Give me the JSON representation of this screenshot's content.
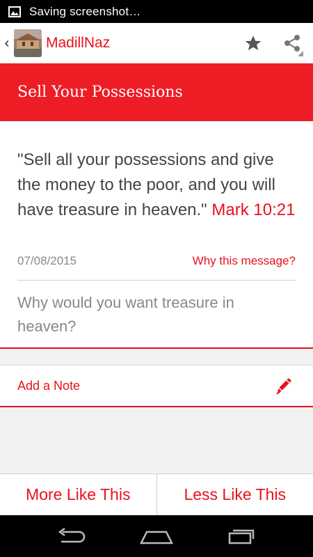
{
  "status_bar": {
    "notification_icon": "image-icon",
    "text": "Saving screenshot…"
  },
  "action_bar": {
    "back_icon": "chevron-left-icon",
    "logo_icon": "church-photo-icon",
    "app_title": "MadillNaz",
    "star_icon": "star-icon",
    "share_icon": "share-icon"
  },
  "message": {
    "title": "Sell Your Possessions",
    "verse_text": "\"Sell all your possessions and give the money to the poor, and you will have treasure in heaven.\"",
    "verse_reference": "Mark 10:21",
    "date": "07/08/2015",
    "why_link": "Why this message?",
    "question": "Why would you want treasure in heaven?"
  },
  "note": {
    "label": "Add a Note",
    "icon": "pencil-icon"
  },
  "feedback": {
    "more_label": "More Like This",
    "less_label": "Less Like This"
  },
  "nav_bar": {
    "back_icon": "back-arrow-icon",
    "home_icon": "home-icon",
    "recents_icon": "recent-apps-icon"
  },
  "colors": {
    "accent": "#ee1c25",
    "accent_text": "#e8111d",
    "muted_text": "#888888",
    "body_text": "#444444"
  }
}
